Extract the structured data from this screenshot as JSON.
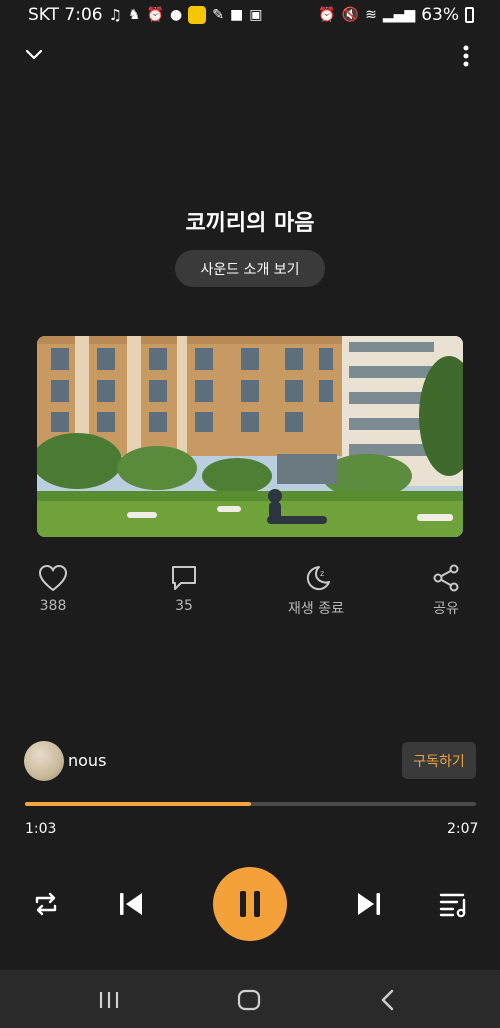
{
  "status_bar": {
    "carrier_time": "SKT 7:06",
    "battery": "63%"
  },
  "track": {
    "title": "코끼리의 마음",
    "intro_button": "사운드 소개 보기"
  },
  "actions": {
    "likes": "388",
    "comments": "35",
    "sleep_timer": "재생 종료",
    "share": "공유"
  },
  "artist": {
    "name": "nous",
    "subscribe_label": "구독하기"
  },
  "playback": {
    "current_time": "1:03",
    "total_time": "2:07",
    "progress": 0.5,
    "accent_color": "#f5a13a"
  },
  "icons": {
    "collapse": "chevron-down-icon",
    "more": "more-vertical-icon",
    "like": "heart-icon",
    "comment": "comment-icon",
    "sleep": "moon-icon",
    "share": "share-icon",
    "repeat": "repeat-icon",
    "previous": "skip-previous-icon",
    "pause": "pause-icon",
    "next": "skip-next-icon",
    "playlist": "playlist-icon"
  }
}
